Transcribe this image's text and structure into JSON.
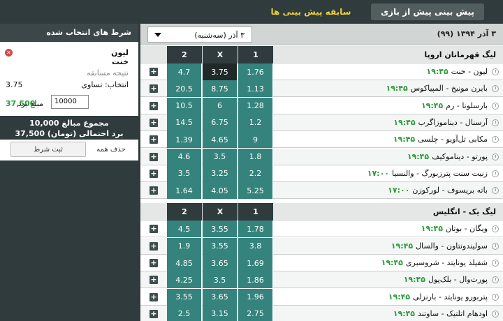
{
  "nav": {
    "pre_label": "پیش بینی پیش از بازی",
    "history_label": "سابقه پیش بینی ها"
  },
  "date": {
    "title": "۳ آذر ۱۳۹۴ (۹۹)",
    "select_value": "۳ آذر (سه‌شنبه)"
  },
  "columns": {
    "one": "1",
    "x": "X",
    "two": "2"
  },
  "leagues": [
    {
      "name": "لیگ قهرمانان اروپا",
      "matches": [
        {
          "teams": "لیون - خنت",
          "time": "۱۹:۴۵",
          "o1": "1.76",
          "ox": "3.75",
          "o2": "4.7"
        },
        {
          "teams": "بایرن مونیخ - المپیاکوس",
          "time": "۱۹:۴۵",
          "o1": "1.13",
          "ox": "8.75",
          "o2": "20.5"
        },
        {
          "teams": "بارسلونا - رم",
          "time": "۱۹:۴۵",
          "o1": "1.28",
          "ox": "6",
          "o2": "10.5"
        },
        {
          "teams": "آرسنال - دیناموزاگرب",
          "time": "۱۹:۴۵",
          "o1": "1.2",
          "ox": "6.75",
          "o2": "14.5"
        },
        {
          "teams": "مکابی تل‌آویو - چلسی",
          "time": "۱۹:۴۵",
          "o1": "9",
          "ox": "4.65",
          "o2": "1.39"
        },
        {
          "teams": "پورتو - دیناموکیف",
          "time": "۱۹:۴۵",
          "o1": "1.8",
          "ox": "3.5",
          "o2": "4.6"
        },
        {
          "teams": "زنیت سنت پترزبورگ - والنسیا",
          "time": "۱۷:۰۰",
          "o1": "2.2",
          "ox": "3.25",
          "o2": "3.5"
        },
        {
          "teams": "باته بریسوف - لورکوزن",
          "time": "۱۷:۰۰",
          "o1": "5.25",
          "ox": "4.05",
          "o2": "1.64"
        }
      ]
    },
    {
      "name": "لیگ یک - انگلیس",
      "matches": [
        {
          "teams": "ویگان - بوتان",
          "time": "۱۹:۴۵",
          "o1": "1.78",
          "ox": "3.55",
          "o2": "4.5"
        },
        {
          "teams": "سولیندونتاون - والسال",
          "time": "۱۹:۴۵",
          "o1": "3.8",
          "ox": "3.55",
          "o2": "1.9"
        },
        {
          "teams": "شفیلد یونایتد - شروسبری",
          "time": "۱۹:۴۵",
          "o1": "1.69",
          "ox": "3.65",
          "o2": "4.85"
        },
        {
          "teams": "پورت‌وال - بلک‌پول",
          "time": "۱۹:۴۵",
          "o1": "1.86",
          "ox": "3.5",
          "o2": "4.25"
        },
        {
          "teams": "پتربورو یونایتد - بارنزلی",
          "time": "۱۹:۴۵",
          "o1": "1.96",
          "ox": "3.65",
          "o2": "3.55"
        },
        {
          "teams": "اودهام اتلتیک - ساوتند",
          "time": "۱۹:۴۵",
          "o1": "2.75",
          "ox": "3.15",
          "o2": "2.5"
        }
      ]
    }
  ],
  "slip": {
    "title": "شرط های انتخاب شده",
    "team1": "لیون",
    "team2": "خنت",
    "result_label": "نتیجه مسابقه",
    "pick": "انتخاب: تساوی",
    "odds": "3.75",
    "stake_value": "10000",
    "win_label": "مبلغ برد",
    "win_value": "37,500",
    "total_stake": "مجموع مبالغ 10,000",
    "potential_win": "برد احتمالی (تومان) 37,500",
    "clear_label": "حذف همه",
    "submit_label": "ثبت شرط"
  },
  "colors": {
    "odds_bg": "#35837d",
    "selected_odd_bg": "#202828",
    "time_green": "#2b9d3a",
    "history_tab": "#f0cf3a"
  }
}
